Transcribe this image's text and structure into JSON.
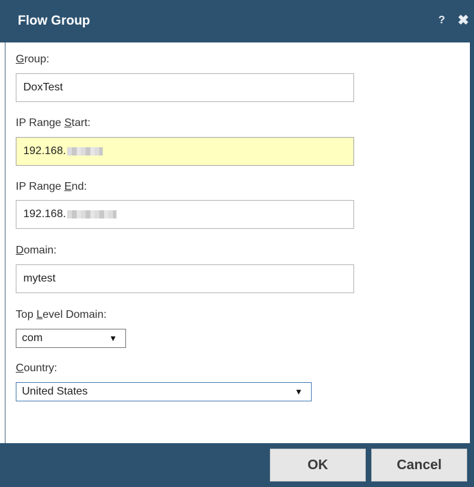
{
  "dialog": {
    "title": "Flow Group",
    "help_glyph": "?",
    "close_glyph": "✖"
  },
  "fields": {
    "group": {
      "label_prefix": "",
      "label_accel": "G",
      "label_rest": "roup:",
      "value": "DoxTest"
    },
    "ip_start": {
      "label_prefix": "IP Range ",
      "label_accel": "S",
      "label_rest": "tart:",
      "value": "192.168."
    },
    "ip_end": {
      "label_prefix": "IP Range ",
      "label_accel": "E",
      "label_rest": "nd:",
      "value": "192.168."
    },
    "domain": {
      "label_prefix": "",
      "label_accel": "D",
      "label_rest": "omain:",
      "value": "mytest"
    },
    "tld": {
      "label_prefix": "Top ",
      "label_accel": "L",
      "label_rest": "evel Domain:",
      "value": "com"
    },
    "country": {
      "label_prefix": "",
      "label_accel": "C",
      "label_rest": "ountry:",
      "value": "United States"
    }
  },
  "icons": {
    "dropdown": "▼"
  },
  "buttons": {
    "ok": "OK",
    "cancel": "Cancel"
  },
  "colors": {
    "header": "#2d5270",
    "focused_field": "#ffffc0"
  }
}
